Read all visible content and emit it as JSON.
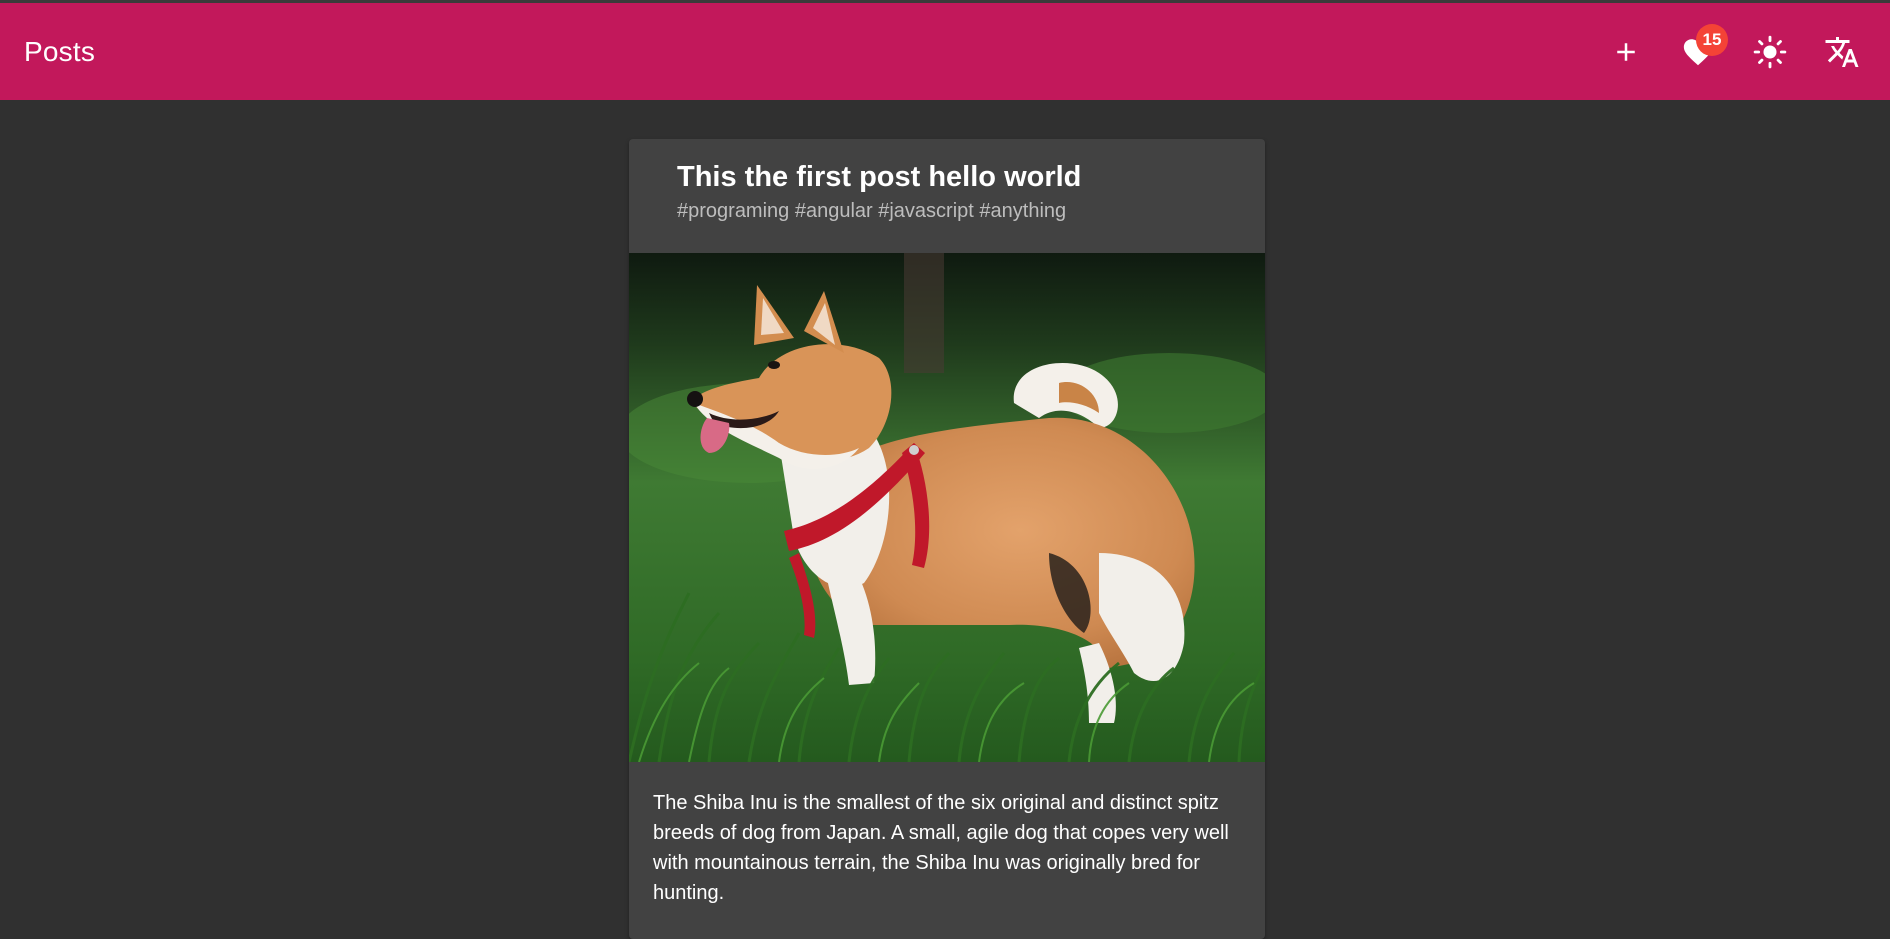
{
  "toolbar": {
    "title": "Posts",
    "buttons": {
      "add_icon": "plus-icon",
      "favorites_icon": "heart-icon",
      "favorites_count": "15",
      "theme_icon": "sun-icon",
      "translate_icon": "translate-icon"
    },
    "color": "#c2185b",
    "badge_color": "#f44336"
  },
  "post": {
    "title": "This the first post hello world",
    "tags": "#programing #angular #javascript #anything",
    "image_alt": "Shiba Inu dog standing in grass",
    "body": "The Shiba Inu is the smallest of the six original and distinct spitz breeds of dog from Japan. A small, agile dog that copes very well with mountainous terrain, the Shiba Inu was originally bred for hunting."
  },
  "theme": {
    "background": "#303030",
    "card": "#424242"
  }
}
